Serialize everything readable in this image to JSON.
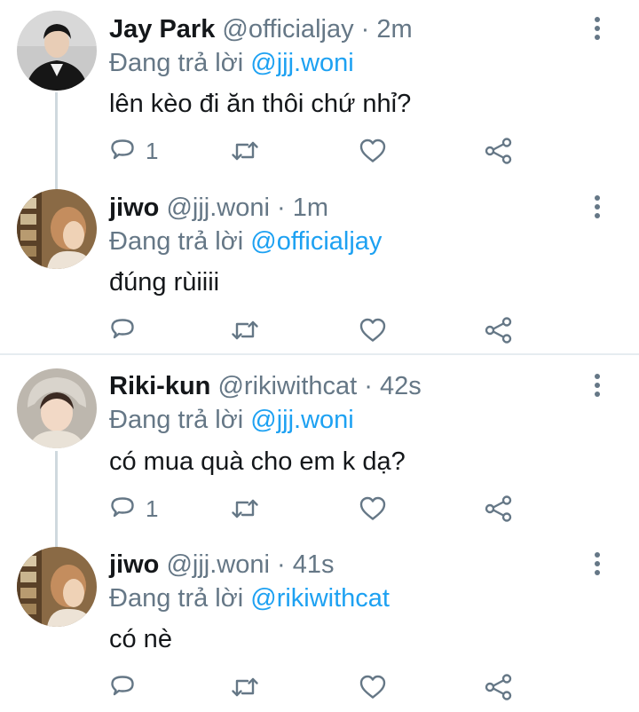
{
  "tweets": [
    {
      "name": "Jay Park",
      "handle": "@officialjay",
      "separator": "·",
      "time": "2m",
      "reply_prefix": "Đang trả lời ",
      "reply_mention": "@jjj.woni",
      "text": "lên kèo đi ăn thôi chứ nhỉ?",
      "reply_count": "1",
      "avatar": "avatar-jay-park"
    },
    {
      "name": "jiwo",
      "handle": "@jjj.woni",
      "separator": "·",
      "time": "1m",
      "reply_prefix": "Đang trả lời ",
      "reply_mention": "@officialjay",
      "text": "đúng rùiiii",
      "reply_count": "",
      "avatar": "avatar-jiwo"
    },
    {
      "name": "Riki-kun",
      "handle": "@rikiwithcat",
      "separator": "·",
      "time": "42s",
      "reply_prefix": "Đang trả lời ",
      "reply_mention": "@jjj.woni",
      "text": "có mua quà cho em k dạ?",
      "reply_count": "1",
      "avatar": "avatar-riki-kun"
    },
    {
      "name": "jiwo",
      "handle": "@jjj.woni",
      "separator": "·",
      "time": "41s",
      "reply_prefix": "Đang trả lời ",
      "reply_mention": "@rikiwithcat",
      "text": "có nè",
      "reply_count": "",
      "avatar": "avatar-jiwo"
    }
  ],
  "icons": {
    "reply": "reply-icon",
    "retweet": "retweet-icon",
    "like": "heart-icon",
    "share": "share-icon",
    "more": "more-vertical-icon"
  },
  "colors": {
    "text": "#14171a",
    "secondary": "#657786",
    "mention": "#1da1f2",
    "thread_line": "#cfd9de",
    "separator": "#e6ecf0"
  }
}
